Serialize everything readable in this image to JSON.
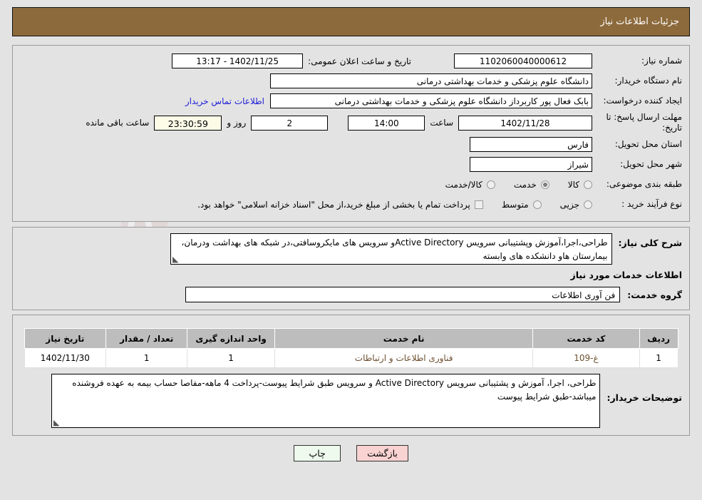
{
  "header": {
    "title": "جزئیات اطلاعات نیاز"
  },
  "form": {
    "need_number_label": "شماره نیاز:",
    "need_number_value": "1102060040000612",
    "announce_label": "تاریخ و ساعت اعلان عمومی:",
    "announce_value": "1402/11/25 - 13:17",
    "buyer_org_label": "نام دستگاه خریدار:",
    "buyer_org_value": "دانشگاه علوم پزشکی و خدمات بهداشتی درمانی",
    "creator_label": "ایجاد کننده درخواست:",
    "creator_value": "بابک فعال پور کاربرداز دانشگاه علوم پزشکی و خدمات بهداشتی درمانی",
    "contact_link": "اطلاعات تماس خریدار",
    "deadline_label": "مهلت ارسال پاسخ: تا تاریخ:",
    "deadline_date": "1402/11/28",
    "hour_label": "ساعت",
    "deadline_hour": "14:00",
    "days_value": "2",
    "days_label": "روز و",
    "countdown": "23:30:59",
    "remaining_label": "ساعت باقی مانده",
    "province_label": "استان محل تحویل:",
    "province_value": "فارس",
    "city_label": "شهر محل تحویل:",
    "city_value": "شیراز",
    "category_label": "طبقه بندی موضوعی:",
    "category_options": [
      {
        "label": "کالا",
        "selected": false
      },
      {
        "label": "خدمت",
        "selected": true
      },
      {
        "label": "کالا/خدمت",
        "selected": false
      }
    ],
    "purchase_type_label": "نوع فرآیند خرید :",
    "purchase_type_options": [
      {
        "label": "جزیی",
        "selected": false
      },
      {
        "label": "متوسط",
        "selected": false
      }
    ],
    "treasury_checkbox_label": "پرداخت تمام یا بخشی از مبلغ خرید،از محل \"اسناد خزانه اسلامی\" خواهد بود.",
    "treasury_checked": false
  },
  "need_description": {
    "label": "شرح کلی نیاز:",
    "value": "طراحی،اجرا،آموزش وپشتیبانی سرویس Active Directoryو سرویس های مایکروسافتی،در شبکه های بهداشت ودرمان، بیمارستان هاو دانشکده های وابسته"
  },
  "services_section": {
    "title": "اطلاعات خدمات مورد نیاز",
    "group_label": "گروه خدمت:",
    "group_value": "فن آوری اطلاعات"
  },
  "table": {
    "headers": [
      "ردیف",
      "کد خدمت",
      "نام خدمت",
      "واحد اندازه گیری",
      "تعداد / مقدار",
      "تاریخ نیاز"
    ],
    "rows": [
      {
        "index": "1",
        "code": "غ-109",
        "name": "فناوری اطلاعات و ارتباطات",
        "unit": "1",
        "quantity": "1",
        "date": "1402/11/30"
      }
    ]
  },
  "buyer_notes": {
    "label": "توضیحات خریدار:",
    "value": "طراحی، اجرا، آموزش و پشتیبانی سرویس Active Directory  و سرویس طبق شرایط پیوست-پرداخت 4 ماهه-مفاصا حساب بیمه به عهده فروشنده میباشد-طبق شرایط پیوست"
  },
  "footer": {
    "print_label": "چاپ",
    "back_label": "بازگشت"
  },
  "watermark": {
    "text": "AriaTender.net"
  },
  "colors": {
    "header_bar": "#8d6a3c",
    "page_bg": "#e3e3e3",
    "link": "#2020d8",
    "timer_bg": "#fbfbe8",
    "print_btn": "#eefaee",
    "back_btn": "#f9d2d2",
    "table_header": "#bdbdbd"
  }
}
